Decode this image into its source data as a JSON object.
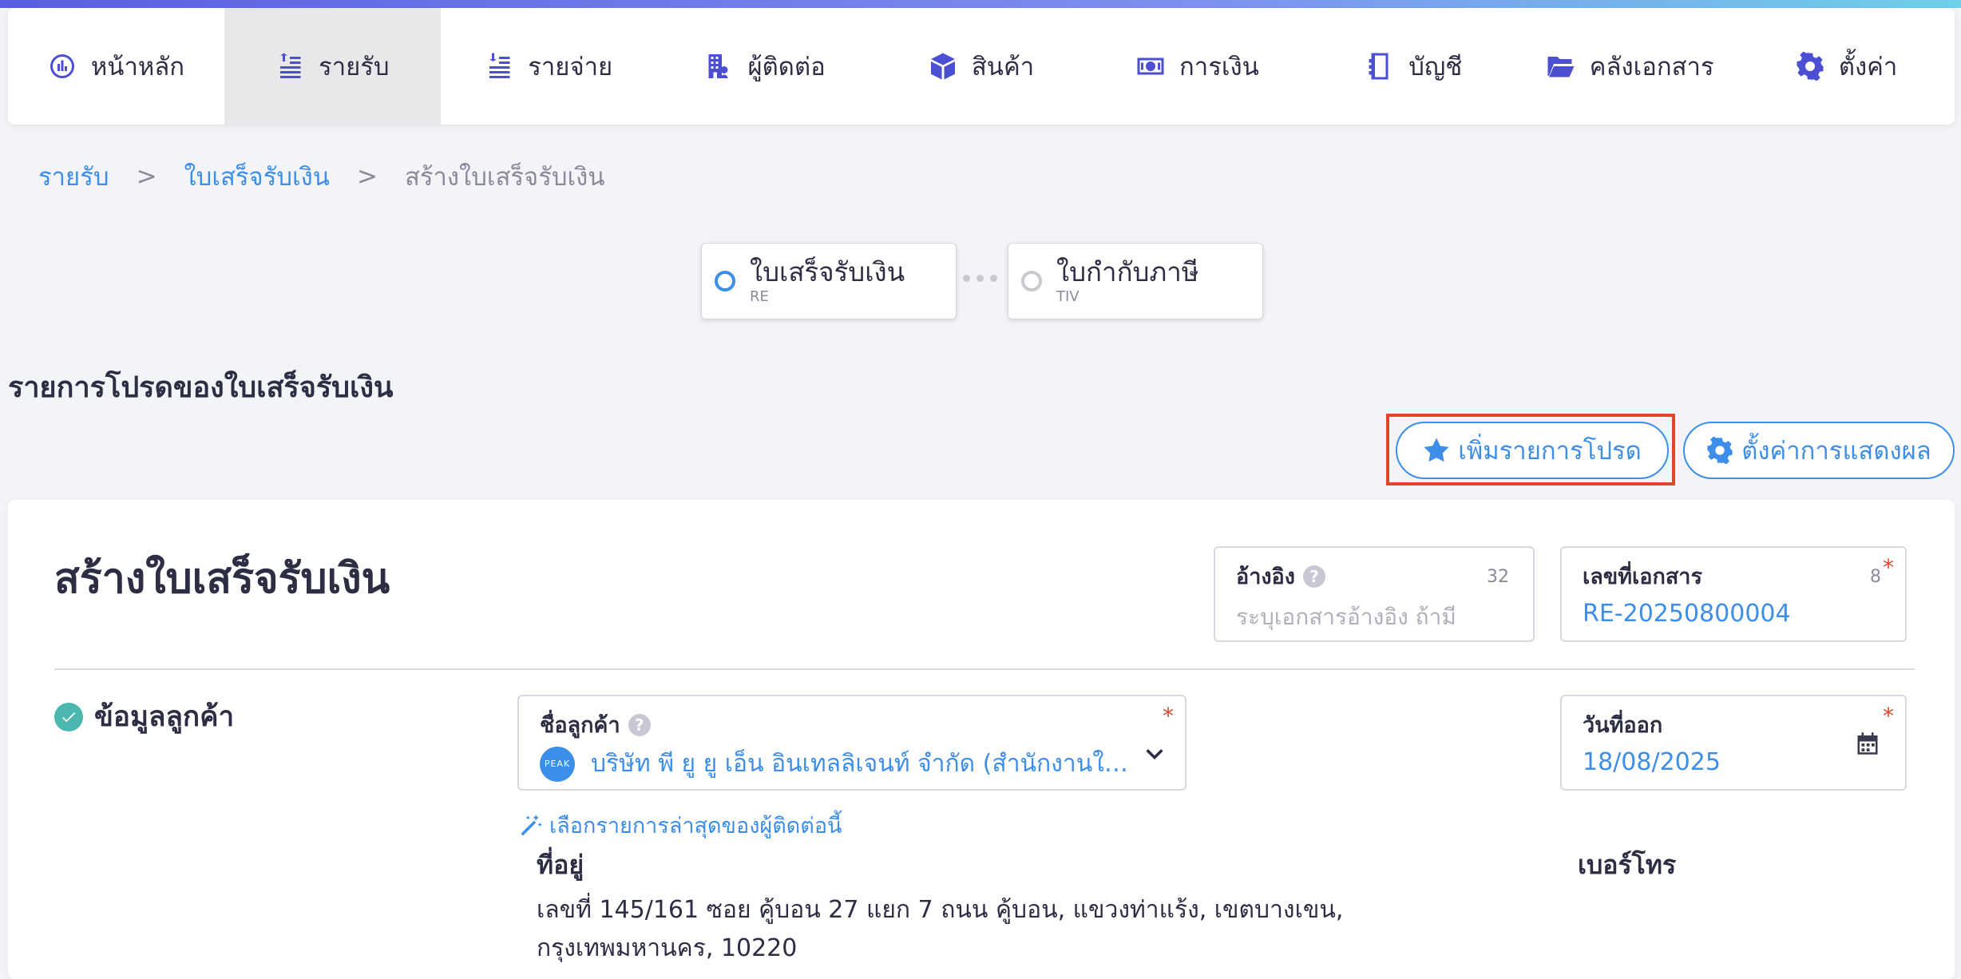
{
  "nav": {
    "items": [
      {
        "label": "หน้าหลัก",
        "icon": "dashboard-icon"
      },
      {
        "label": "รายรับ",
        "icon": "income-coins-icon",
        "active": true
      },
      {
        "label": "รายจ่าย",
        "icon": "expense-coins-icon"
      },
      {
        "label": "ผู้ติดต่อ",
        "icon": "contacts-building-icon"
      },
      {
        "label": "สินค้า",
        "icon": "product-box-icon"
      },
      {
        "label": "การเงิน",
        "icon": "money-bill-icon"
      },
      {
        "label": "บัญชี",
        "icon": "account-book-icon"
      },
      {
        "label": "คลังเอกสาร",
        "icon": "folder-open-icon"
      },
      {
        "label": "ตั้งค่า",
        "icon": "gear-icon"
      }
    ]
  },
  "breadcrumb": {
    "level1": "รายรับ",
    "sep1": ">",
    "level2": "ใบเสร็จรับเงิน",
    "sep2": ">",
    "current": "สร้างใบเสร็จรับเงิน"
  },
  "flow": {
    "step1": {
      "title": "ใบเสร็จรับเงิน",
      "code": "RE"
    },
    "step2": {
      "title": "ใบกำกับภาษี",
      "code": "TIV"
    }
  },
  "favorites": {
    "title": "รายการโปรดของใบเสร็จรับเงิน",
    "add_label": "เพิ่มรายการโปรด",
    "display_settings_label": "ตั้งค่าการแสดงผล"
  },
  "form": {
    "title": "สร้างใบเสร็จรับเงิน",
    "reference": {
      "label": "อ้างอิง",
      "count": "32",
      "placeholder": "ระบุเอกสารอ้างอิง ถ้ามี"
    },
    "doc_number": {
      "label": "เลขที่เอกสาร",
      "count": "8",
      "value": "RE-20250800004"
    },
    "customer_section_title": "ข้อมูลลูกค้า",
    "customer": {
      "label": "ชื่อลูกค้า",
      "logo_text": "PEAK",
      "value": "บริษัท พี ยู ยู เอ็น อินเทลลิเจนท์ จำกัด (สำนักงานให..."
    },
    "issue_date": {
      "label": "วันที่ออก",
      "value": "18/08/2025"
    },
    "latest_link": "เลือกรายการล่าสุดของผู้ติดต่อนี้",
    "address_label": "ที่อยู่",
    "address_value": "เลขที่ 145/161 ซอย คู้บอน 27 แยก 7 ถนน คู้บอน, แขวงท่าแร้ง, เขตบางเขน, กรุงเทพมหานคร, 10220",
    "phone_label": "เบอร์โทร",
    "required_mark": "*",
    "help_mark": "?"
  }
}
